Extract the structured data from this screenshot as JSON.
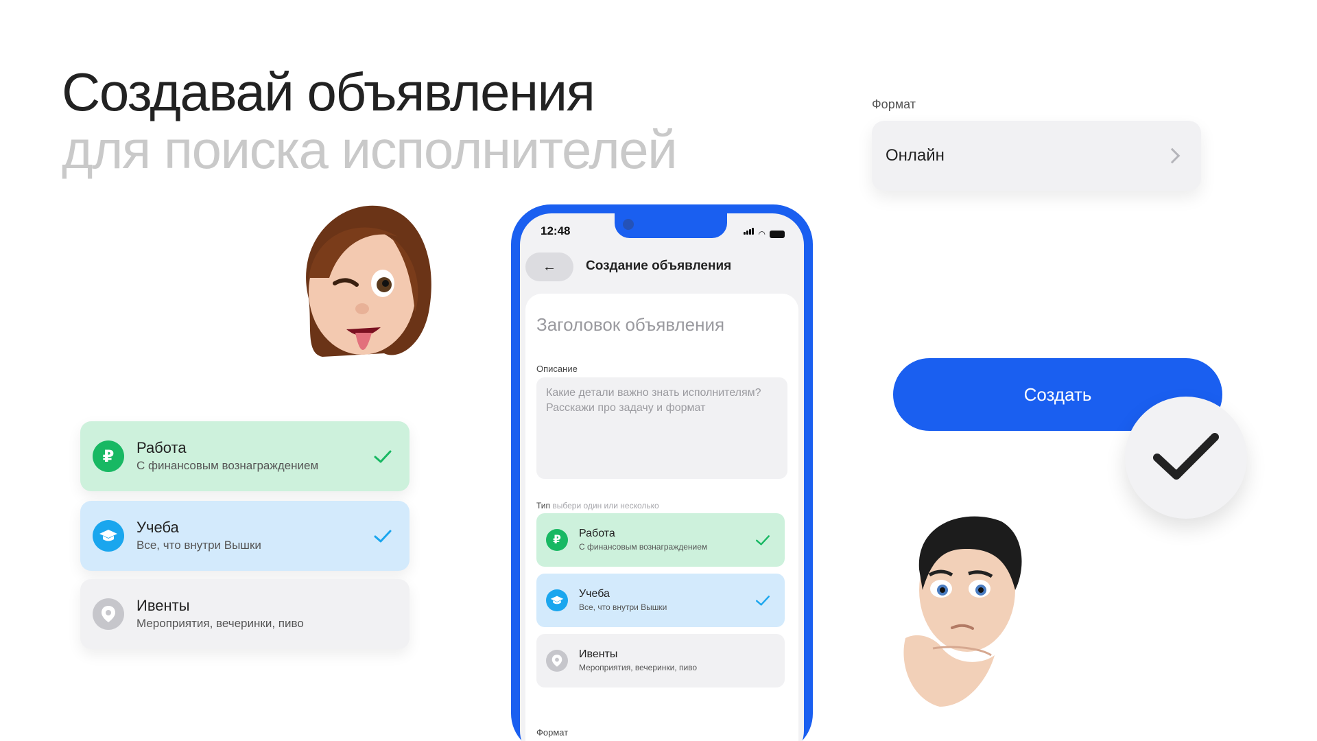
{
  "headline": {
    "line1": "Создавай объявления",
    "line2": "для поиска исполнителей"
  },
  "format_widget": {
    "label": "Формат",
    "value": "Онлайн",
    "icon": "chevron-right-icon"
  },
  "create_button": {
    "label": "Создать",
    "check_icon": "checkmark-icon"
  },
  "category_cards": [
    {
      "title": "Работа",
      "subtitle": "С финансовым вознаграждением",
      "icon": "ruble-icon",
      "selected": true,
      "color": "#cdf1dc"
    },
    {
      "title": "Учеба",
      "subtitle": "Все, что внутри Вышки",
      "icon": "graduation-cap-icon",
      "selected": true,
      "color": "#d3eafc"
    },
    {
      "title": "Ивенты",
      "subtitle": "Мероприятия, вечеринки, пиво",
      "icon": "location-pin-icon",
      "selected": false,
      "color": "#f1f1f3"
    }
  ],
  "phone": {
    "status_time": "12:48",
    "screen_title": "Создание объявления",
    "title_placeholder": "Заголовок объявления",
    "description_label": "Описание",
    "description_placeholder": "Какие детали важно знать исполнителям? Расскажи про задачу и формат",
    "type_label": "Тип",
    "type_hint": "выбери один или несколько",
    "format_label": "Формат",
    "type_cards": [
      {
        "title": "Работа",
        "subtitle": "С финансовым вознаграждением",
        "selected": true
      },
      {
        "title": "Учеба",
        "subtitle": "Все, что внутри Вышки",
        "selected": true
      },
      {
        "title": "Ивенты",
        "subtitle": "Мероприятия, вечеринки, пиво",
        "selected": false
      }
    ]
  },
  "colors": {
    "accent": "#1a5ff0",
    "green": "#18b863",
    "blue": "#1aa6ee"
  }
}
